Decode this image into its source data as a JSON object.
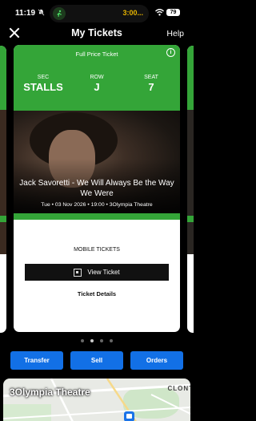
{
  "status_bar": {
    "time": "11:19",
    "live_activity_time": "3:00...",
    "battery": "79"
  },
  "header": {
    "title": "My Tickets",
    "help_label": "Help"
  },
  "ticket": {
    "price_type": "Full Price Ticket",
    "section_label": "SEC",
    "section_value": "STALLS",
    "row_label": "ROW",
    "row_value": "J",
    "seat_label": "SEAT",
    "seat_value": "7",
    "event_title": "Jack Savoretti - We Will Always Be the Way We Were",
    "event_subtitle": "Tue • 03 Nov 2026 • 19:00 • 3Olympia Theatre",
    "mobile_label": "MOBILE TICKETS",
    "view_ticket_label": "View Ticket",
    "details_label": "Ticket Details"
  },
  "pager": {
    "count": 4,
    "active_index": 1
  },
  "actions": {
    "transfer_label": "Transfer",
    "sell_label": "Sell",
    "orders_label": "Orders"
  },
  "map": {
    "venue_label": "3Olympia Theatre",
    "area_label": "CLONT"
  },
  "colors": {
    "brand_green": "#34a538",
    "action_blue": "#1270e6",
    "island_time": "#e5b300"
  },
  "icons": [
    "bell-slash-icon",
    "running-icon",
    "wifi-icon",
    "battery-icon",
    "close-icon",
    "info-icon",
    "qr-icon",
    "train-icon"
  ]
}
